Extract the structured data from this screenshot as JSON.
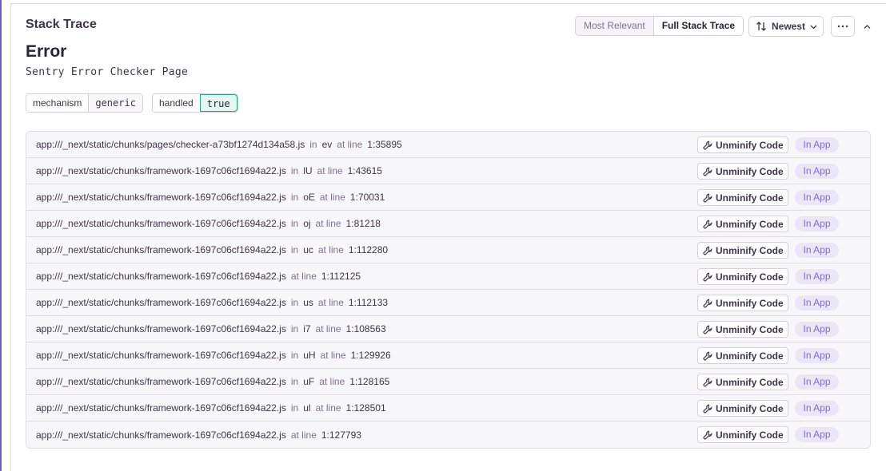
{
  "section": {
    "title": "Stack Trace",
    "view_options": [
      "Most Relevant",
      "Full Stack Trace"
    ],
    "active_view": "Full Stack Trace",
    "sort_label": "Newest"
  },
  "error": {
    "title": "Error",
    "message": "Sentry Error Checker Page"
  },
  "tags": [
    {
      "key": "mechanism",
      "value": "generic"
    },
    {
      "key": "handled",
      "value": "true"
    }
  ],
  "frame_labels": {
    "in": "in",
    "at_line": "at line",
    "unminify": "Unminify Code",
    "in_app": "In App"
  },
  "frames": [
    {
      "file": "app:///_next/static/chunks/pages/checker-a73bf1274d134a58.js",
      "function": "ev",
      "line": "1:35895"
    },
    {
      "file": "app:///_next/static/chunks/framework-1697c06cf1694a22.js",
      "function": "lU",
      "line": "1:43615"
    },
    {
      "file": "app:///_next/static/chunks/framework-1697c06cf1694a22.js",
      "function": "oE",
      "line": "1:70031"
    },
    {
      "file": "app:///_next/static/chunks/framework-1697c06cf1694a22.js",
      "function": "oj",
      "line": "1:81218"
    },
    {
      "file": "app:///_next/static/chunks/framework-1697c06cf1694a22.js",
      "function": "uc",
      "line": "1:112280"
    },
    {
      "file": "app:///_next/static/chunks/framework-1697c06cf1694a22.js",
      "function": "",
      "line": "1:112125"
    },
    {
      "file": "app:///_next/static/chunks/framework-1697c06cf1694a22.js",
      "function": "us",
      "line": "1:112133"
    },
    {
      "file": "app:///_next/static/chunks/framework-1697c06cf1694a22.js",
      "function": "i7",
      "line": "1:108563"
    },
    {
      "file": "app:///_next/static/chunks/framework-1697c06cf1694a22.js",
      "function": "uH",
      "line": "1:129926"
    },
    {
      "file": "app:///_next/static/chunks/framework-1697c06cf1694a22.js",
      "function": "uF",
      "line": "1:128165"
    },
    {
      "file": "app:///_next/static/chunks/framework-1697c06cf1694a22.js",
      "function": "ul",
      "line": "1:128501"
    },
    {
      "file": "app:///_next/static/chunks/framework-1697c06cf1694a22.js",
      "function": "",
      "line": "1:127793"
    }
  ],
  "colors": {
    "accent": "#6c5fc7",
    "in_app_badge_bg": "#ebe6f5",
    "in_app_badge_text": "#7b6ed0",
    "handled_true_border": "#2ba185"
  },
  "icons": [
    "sort-icon",
    "chevron-down-icon",
    "ellipsis-icon",
    "chevron-up-icon",
    "wrench-icon"
  ]
}
